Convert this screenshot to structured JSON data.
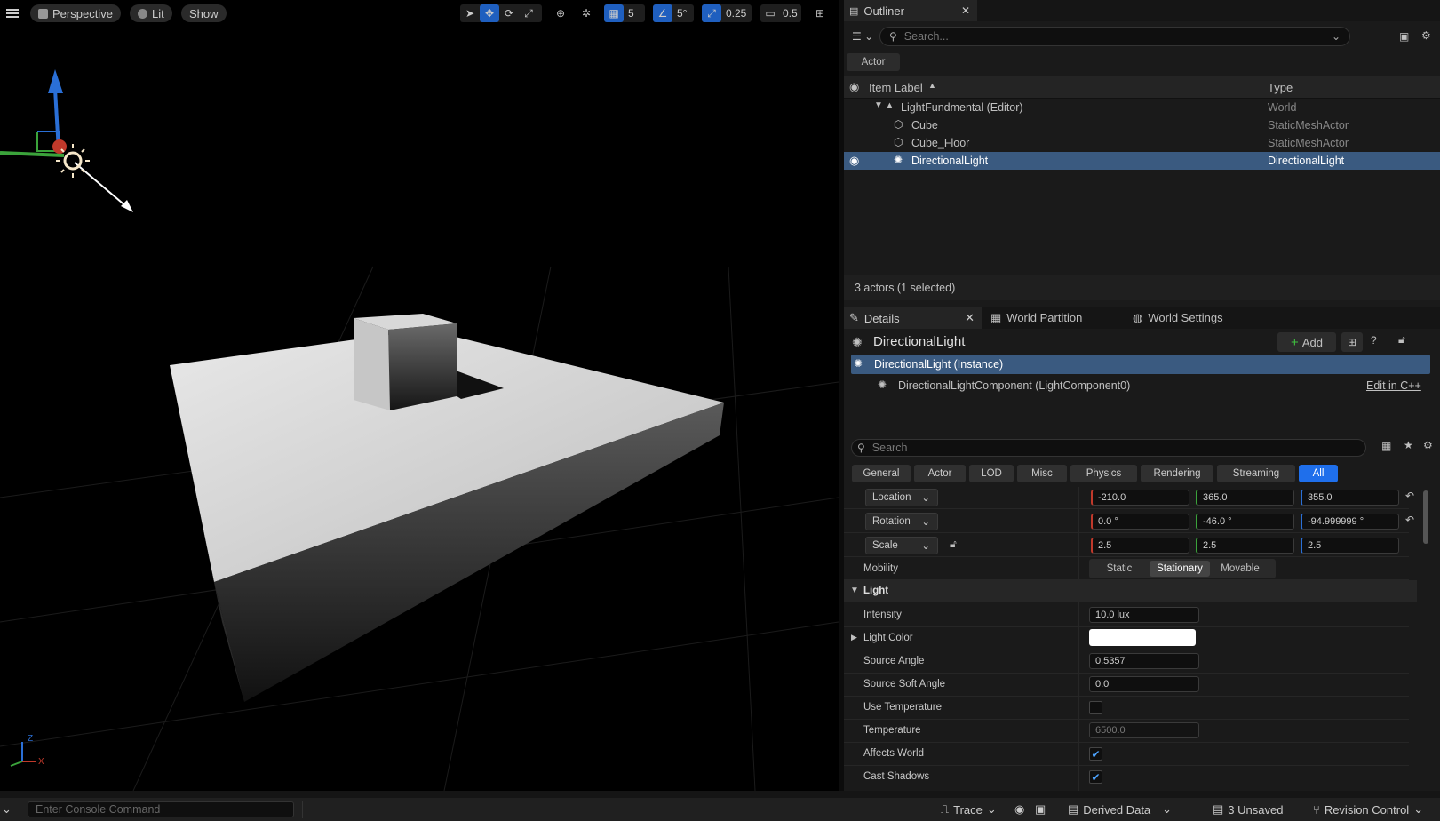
{
  "viewport": {
    "menu_icon": "hamburger-icon",
    "perspective_label": "Perspective",
    "lit_label": "Lit",
    "show_label": "Show",
    "grid_snap": "5",
    "rotation_snap": "5°",
    "scale_snap": "0.25",
    "camera_speed": "0.5",
    "axis_x": "X",
    "axis_z": "Z"
  },
  "outliner": {
    "tab_label": "Outliner",
    "search_placeholder": "Search...",
    "filter_chip": "Actor",
    "col_label": "Item Label",
    "col_type": "Type",
    "rows": [
      {
        "label": "LightFundmental (Editor)",
        "type": "World"
      },
      {
        "label": "Cube",
        "type": "StaticMeshActor"
      },
      {
        "label": "Cube_Floor",
        "type": "StaticMeshActor"
      },
      {
        "label": "DirectionalLight",
        "type": "DirectionalLight"
      }
    ],
    "status": "3 actors (1 selected)"
  },
  "details": {
    "tabs": [
      "Details",
      "World Partition",
      "World Settings"
    ],
    "actor_name": "DirectionalLight",
    "add_label": "Add",
    "instance_label": "DirectionalLight (Instance)",
    "component_label": "DirectionalLightComponent (LightComponent0)",
    "edit_cpp": "Edit in C++",
    "search_placeholder": "Search",
    "categories": [
      "General",
      "Actor",
      "LOD",
      "Misc",
      "Physics",
      "Rendering",
      "Streaming",
      "All"
    ],
    "transform": {
      "location_label": "Location",
      "location": [
        "-210.0",
        "365.0",
        "355.0"
      ],
      "rotation_label": "Rotation",
      "rotation": [
        "0.0 °",
        "-46.0 °",
        "-94.999999 °"
      ],
      "scale_label": "Scale",
      "scale": [
        "2.5",
        "2.5",
        "2.5"
      ]
    },
    "mobility_label": "Mobility",
    "mobility_options": [
      "Static",
      "Stationary",
      "Movable"
    ],
    "light_section": "Light",
    "intensity_label": "Intensity",
    "intensity": "10.0 lux",
    "light_color_label": "Light Color",
    "source_angle_label": "Source Angle",
    "source_angle": "0.5357",
    "source_soft_angle_label": "Source Soft Angle",
    "source_soft_angle": "0.0",
    "use_temperature_label": "Use Temperature",
    "temperature_label": "Temperature",
    "temperature": "6500.0",
    "affects_world_label": "Affects World",
    "cast_shadows_label": "Cast Shadows"
  },
  "statusbar": {
    "console_placeholder": "Enter Console Command",
    "trace": "Trace",
    "derived_data": "Derived Data",
    "unsaved": "3 Unsaved",
    "revision_control": "Revision Control"
  },
  "colors": {
    "accent": "#1f5fbf",
    "selected_row": "#3a5a80",
    "check": "#4da3ff"
  }
}
